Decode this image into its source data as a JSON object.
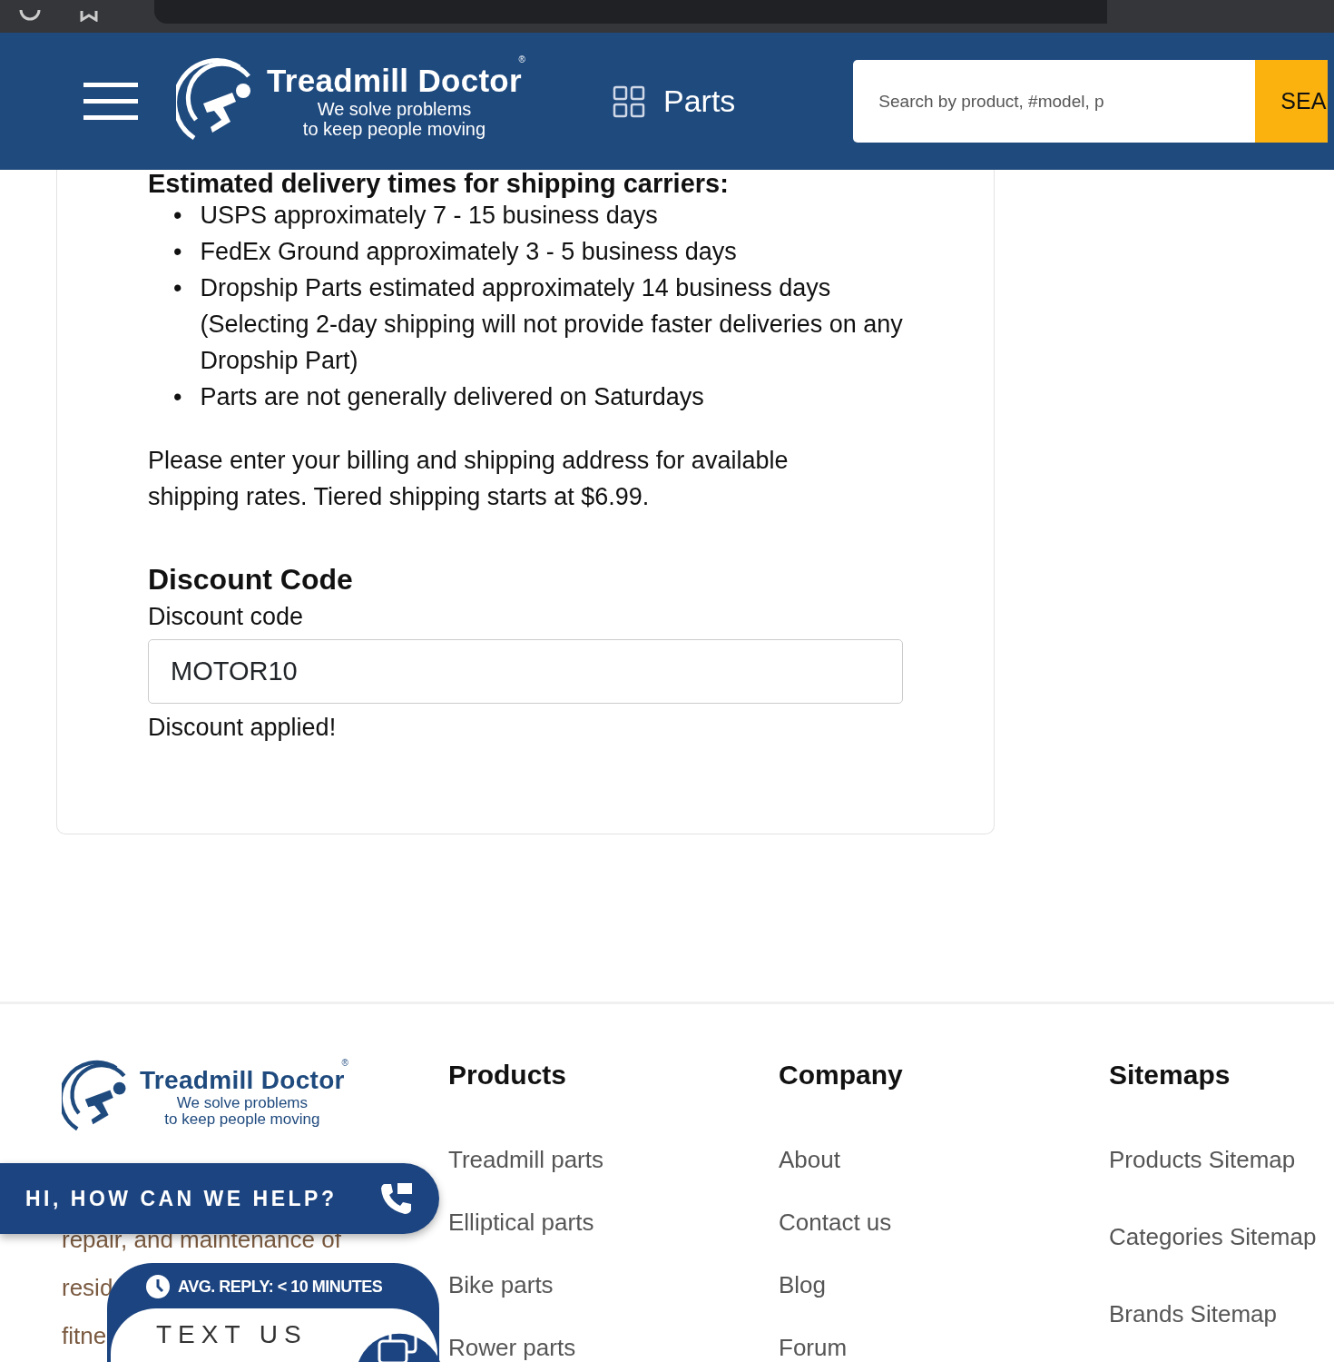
{
  "header": {
    "logo": {
      "name": "Treadmill Doctor",
      "mark": "®",
      "tagline_1": "We solve problems",
      "tagline_2": "to keep people moving"
    },
    "parts_link": "Parts",
    "search": {
      "placeholder": "Search by product, #model, p",
      "button": "SEA"
    }
  },
  "delivery": {
    "heading": "Estimated delivery times for shipping carriers:",
    "bullet": "•",
    "items": [
      "USPS approximately 7 - 15 business days",
      "FedEx Ground approximately 3 - 5 business days",
      "Dropship Parts estimated approximately 14 business days (Selecting 2-day shipping will not provide faster deliveries on any Dropship Part)",
      "Parts are not generally delivered on Saturdays"
    ]
  },
  "note": "Please enter your billing and shipping address for available shipping rates. Tiered shipping starts at $6.99.",
  "discount": {
    "heading": "Discount Code",
    "label": "Discount code",
    "value": "MOTOR10",
    "message": "Discount applied!"
  },
  "footer": {
    "logo": {
      "name": "Treadmill Doctor",
      "mark": "®",
      "tagline_1": "We solve problems",
      "tagline_2": "to keep people moving"
    },
    "description_fragments": [
      "repair, and maintenance of",
      "resid",
      "fitne"
    ],
    "columns": [
      {
        "heading": "Products",
        "links": [
          "Treadmill parts",
          "Elliptical parts",
          "Bike parts",
          "Rower parts"
        ]
      },
      {
        "heading": "Company",
        "links": [
          "About",
          "Contact us",
          "Blog",
          "Forum"
        ]
      },
      {
        "heading": "Sitemaps",
        "links": [
          "Products Sitemap",
          "Categories Sitemap",
          "Brands Sitemap"
        ]
      }
    ]
  },
  "chat": {
    "help": "HI, HOW CAN WE HELP?",
    "avg_reply": "AVG. REPLY: < 10 MINUTES",
    "text_us": "TEXT US"
  }
}
